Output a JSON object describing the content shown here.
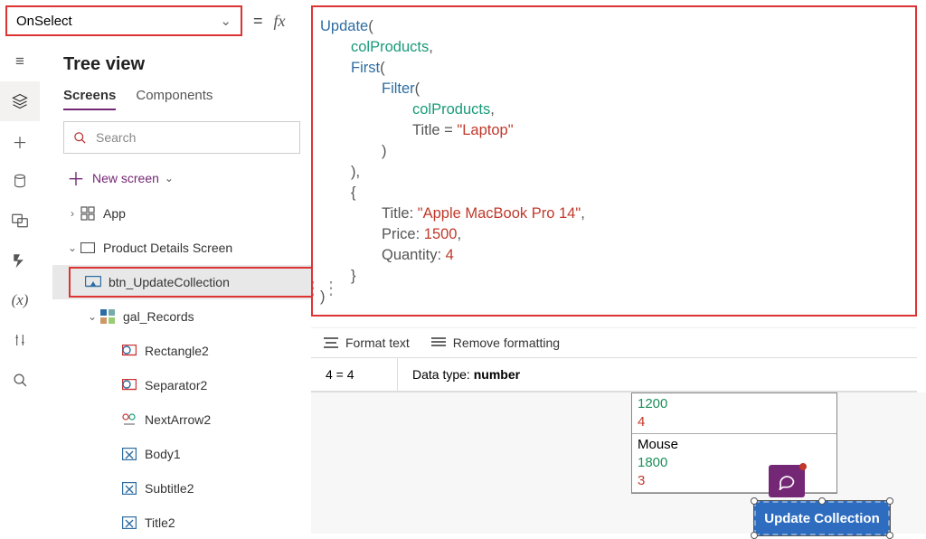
{
  "property_dropdown": {
    "value": "OnSelect"
  },
  "tree": {
    "title": "Tree view",
    "tabs": {
      "screens": "Screens",
      "components": "Components"
    },
    "search_placeholder": "Search",
    "new_screen": "New screen",
    "app": "App",
    "screen": "Product Details Screen",
    "btn": "btn_UpdateCollection",
    "gal": "gal_Records",
    "r2": "Rectangle2",
    "sep2": "Separator2",
    "na2": "NextArrow2",
    "b1": "Body1",
    "s2": "Subtitle2",
    "t2": "Title2"
  },
  "formula": {
    "fn_update": "Update",
    "col": "colProducts",
    "fn_first": "First",
    "fn_filter": "Filter",
    "title_field": "Title",
    "laptop": "\"Laptop\"",
    "k_title": "Title",
    "v_title": "\"Apple MacBook Pro 14\"",
    "k_price": "Price",
    "v_price": "1500",
    "k_qty": "Quantity",
    "v_qty": "4"
  },
  "format": {
    "format_text": "Format text",
    "remove_fmt": "Remove formatting"
  },
  "result": {
    "expr": "4 = 4",
    "dt_label": "Data type:",
    "dt_value": "number"
  },
  "gallery": {
    "r1": {
      "price": "1200",
      "qty": "4"
    },
    "r2": {
      "title": "Mouse",
      "price": "1800",
      "qty": "3"
    }
  },
  "update_button": "Update Collection"
}
